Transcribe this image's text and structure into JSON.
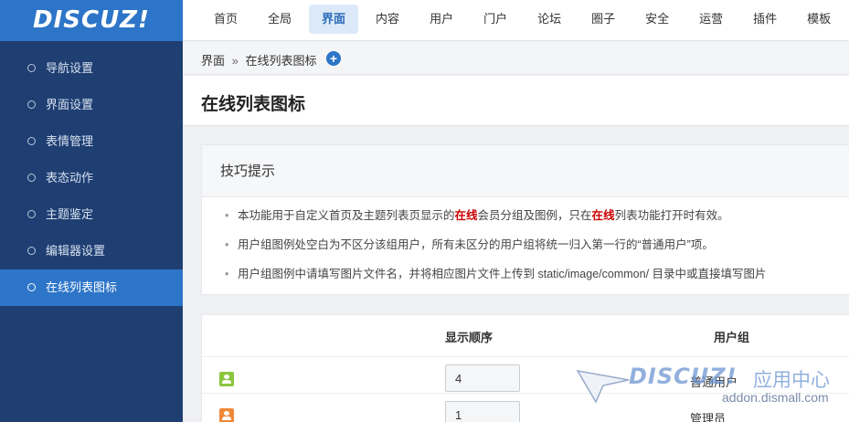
{
  "logo": {
    "text": "DISCUZ!"
  },
  "topnav": [
    {
      "label": "首页",
      "active": false
    },
    {
      "label": "全局",
      "active": false
    },
    {
      "label": "界面",
      "active": true
    },
    {
      "label": "内容",
      "active": false
    },
    {
      "label": "用户",
      "active": false
    },
    {
      "label": "门户",
      "active": false
    },
    {
      "label": "论坛",
      "active": false
    },
    {
      "label": "圈子",
      "active": false
    },
    {
      "label": "安全",
      "active": false
    },
    {
      "label": "运营",
      "active": false
    },
    {
      "label": "插件",
      "active": false
    },
    {
      "label": "模板",
      "active": false
    }
  ],
  "sidebar": {
    "items": [
      {
        "label": "导航设置"
      },
      {
        "label": "界面设置"
      },
      {
        "label": "表情管理"
      },
      {
        "label": "表态动作"
      },
      {
        "label": "主题鉴定"
      },
      {
        "label": "编辑器设置"
      },
      {
        "label": "在线列表图标"
      }
    ],
    "active_index": 6
  },
  "breadcrumb": {
    "parent": "界面",
    "separator": "»",
    "current": "在线列表图标",
    "plus_symbol": "+"
  },
  "page_title": "在线列表图标",
  "tips": {
    "heading": "技巧提示",
    "items": [
      {
        "pre": "本功能用于自定义首页及主题列表页显示的",
        "hl1": "在线",
        "mid": "会员分组及图例，只在",
        "hl2": "在线",
        "post": "列表功能打开时有效。"
      },
      {
        "pre": "用户组图例处空白为不区分该组用户，所有未区分的用户组将统一归入第一行的“普通用户”项。"
      },
      {
        "pre": "用户组图例中请填写图片文件名，并将相应图片文件上传到 static/image/common/ 目录中或直接填写图片"
      }
    ],
    "bullet": "•"
  },
  "table": {
    "headers": {
      "order": "显示顺序",
      "group": "用户组"
    },
    "rows": [
      {
        "icon_color": "#8cc63f",
        "order": "4",
        "group": "普通用户"
      },
      {
        "icon_color": "#f0883a",
        "order": "1",
        "group": "管理员"
      }
    ]
  },
  "watermark": {
    "logo": "DISCUZ!",
    "cn": "应用中心",
    "url": "addon.dismall.com"
  },
  "colors": {
    "brand": "#2d75c8",
    "sidebar": "#1f3f73",
    "highlight": "#cc0000"
  }
}
